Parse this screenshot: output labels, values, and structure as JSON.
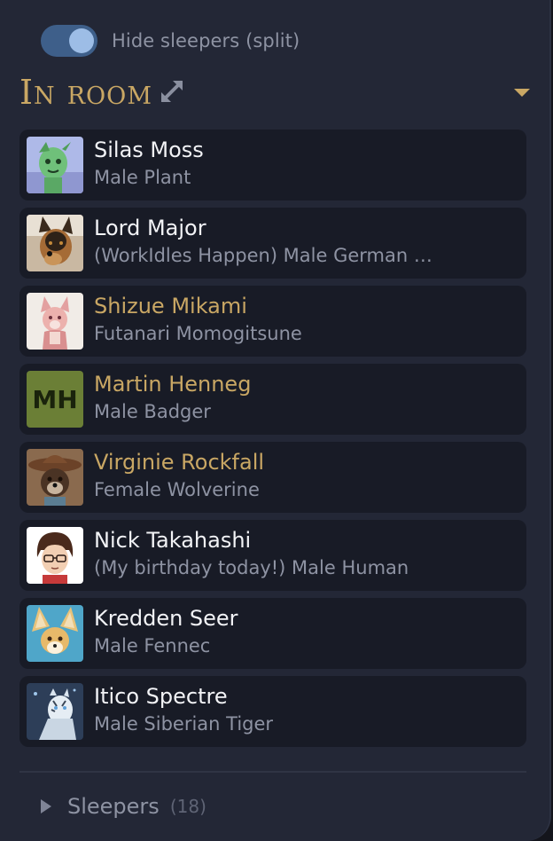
{
  "toggle": {
    "label": "Hide sleepers (split)",
    "on": true
  },
  "section": {
    "title": "In room",
    "expand_icon": "expand-arrows-icon",
    "collapse_icon": "triangle-down-icon"
  },
  "characters": [
    {
      "name": "Silas Moss",
      "subtitle": "Male Plant",
      "highlight": false,
      "avatar": "green-plant-creature-portrait"
    },
    {
      "name": "Lord Major",
      "subtitle": "(WorkIdles Happen) Male German …",
      "highlight": false,
      "avatar": "german-shepherd-portrait"
    },
    {
      "name": "Shizue Mikami",
      "subtitle": "Futanari Momogitsune",
      "highlight": true,
      "avatar": "pink-fox-portrait"
    },
    {
      "name": "Martin Henneg",
      "subtitle": "Male Badger",
      "highlight": true,
      "avatar_initials": "MH"
    },
    {
      "name": "Virginie Rockfall",
      "subtitle": "Female Wolverine",
      "highlight": true,
      "avatar": "wolverine-cowboy-hat-portrait"
    },
    {
      "name": "Nick Takahashi",
      "subtitle": "(My birthday today!) Male Human",
      "highlight": false,
      "avatar": "human-glasses-portrait"
    },
    {
      "name": "Kredden Seer",
      "subtitle": "Male Fennec",
      "highlight": false,
      "avatar": "fennec-portrait"
    },
    {
      "name": "Itico Spectre",
      "subtitle": "Male Siberian Tiger",
      "highlight": false,
      "avatar": "white-tiger-portrait"
    }
  ],
  "sleepers": {
    "label": "Sleepers",
    "count": "(18)",
    "icon": "caret-right-icon"
  },
  "colors": {
    "panel_bg": "#232736",
    "card_bg": "#181b26",
    "gold": "#c9a764",
    "text": "#f2f3f6",
    "muted": "#8e93a3",
    "toggle_bg": "#3e5f8a"
  }
}
